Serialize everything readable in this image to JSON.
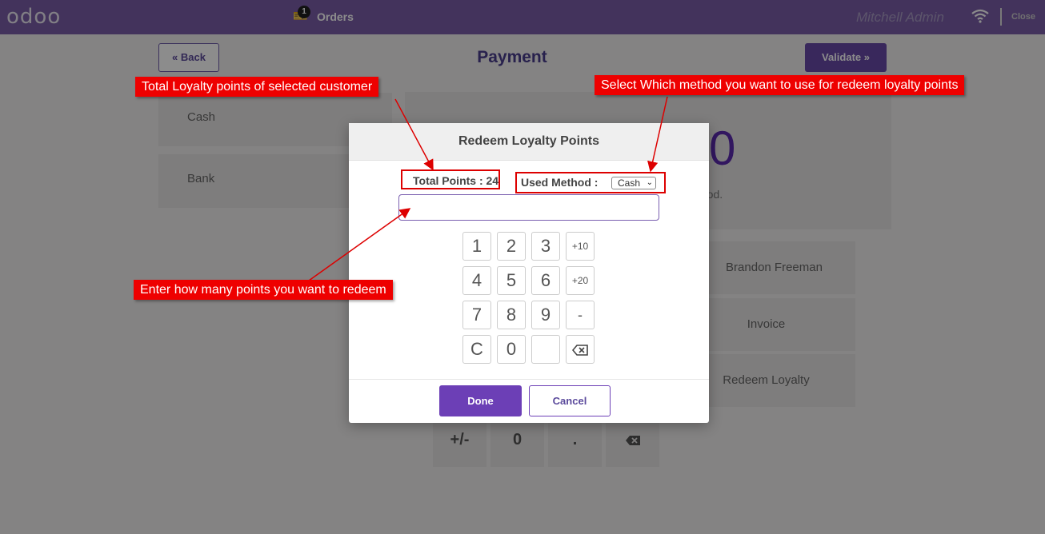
{
  "topbar": {
    "logo": "odoo",
    "orders_count": "1",
    "orders_label": "Orders",
    "user_name": "Mitchell Admin",
    "close_label": "Close"
  },
  "payment_screen": {
    "back_label": "Back",
    "title": "Payment",
    "validate_label": "Validate",
    "payment_methods": [
      "Cash",
      "Bank"
    ],
    "summary_amount": "0",
    "summary_hint": "thod.",
    "actions": [
      "Brandon Freeman",
      "Invoice",
      "Redeem Loyalty"
    ],
    "numpad_bottom": [
      "+/-",
      "0",
      "."
    ]
  },
  "modal": {
    "title": "Redeem Loyalty Points",
    "total_points_label": "Total Points : 24",
    "used_method_label": "Used Method :",
    "method_selected": "Cash",
    "points_input_value": "",
    "keys": [
      "1",
      "2",
      "3",
      "+10",
      "4",
      "5",
      "6",
      "+20",
      "7",
      "8",
      "9",
      "-",
      "C",
      "0",
      "",
      "backspace"
    ],
    "done_label": "Done",
    "cancel_label": "Cancel"
  },
  "annotations": {
    "total_points_note": "Total Loyalty points of selected customer",
    "method_note": "Select Which method you want to use for redeem loyalty points",
    "enter_points_note": "Enter how many points you want to redeem"
  },
  "colors": {
    "topbar": "#7b5ea8",
    "accent": "#6c3fb6",
    "annotation": "#ee0000"
  }
}
